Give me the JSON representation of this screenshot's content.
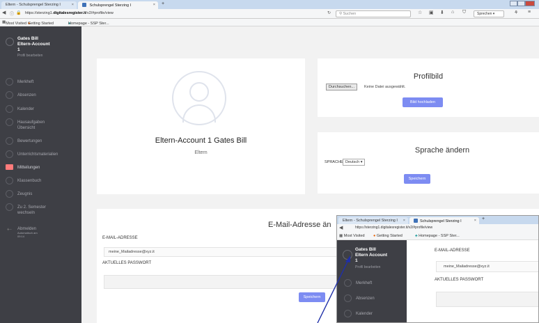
{
  "browser": {
    "tabs": [
      {
        "label": "Eltern - Schulsprengel Sterzing I"
      },
      {
        "label": "Schulsprengel Sterzing I"
      }
    ],
    "new_tab": "+",
    "url_prefix": "https://sterzing1.",
    "url_domain": "digitalesregister.it",
    "url_suffix": "/v2/#profile/view",
    "search_placeholder": "Suchen",
    "menu_label": "Sprechen",
    "bookmarks": [
      "Most Visited",
      "Getting Started",
      "Homepage - SSP Ster..."
    ]
  },
  "sidebar": {
    "user_name_line1": "Gates Bill",
    "user_name_line2": "Eltern-Account",
    "user_name_line3": "1",
    "edit_profile": "Profil bearbeiten",
    "items": [
      {
        "label": "Merkheft"
      },
      {
        "label": "Absenzen"
      },
      {
        "label": "Kalender"
      },
      {
        "label": "Hausaufgaben Übersicht"
      },
      {
        "label": "Bewertungen"
      },
      {
        "label": "Unterrichtsmaterialien"
      },
      {
        "label": "Mitteilungen"
      },
      {
        "label": "Klassenbuch"
      },
      {
        "label": "Zeugnis"
      },
      {
        "label": "Zu 2. Semester wechseln"
      }
    ],
    "logout": "Abmelden",
    "logout_sub_line1": "Automatisch am",
    "logout_sub_line2": "09:14"
  },
  "profile": {
    "name": "Eltern-Account 1 Gates Bill",
    "role": "Eltern"
  },
  "profilbild": {
    "title": "Profilbild",
    "browse_button": "Durchsuchen...",
    "no_file": "Keine Datei ausgewählt.",
    "upload_button": "Bild hochladen"
  },
  "language": {
    "title": "Sprache ändern",
    "label": "SPRACHE",
    "selected": "Deutsch",
    "save_button": "Speichern"
  },
  "email": {
    "title": "E-Mail-Adresse än",
    "email_label": "E-MAIL-ADRESSE",
    "email_value": "meine_Mailadresse@xyz.it",
    "password_label": "AKTUELLES PASSWORT",
    "password_value": "",
    "save_button": "Speichern"
  },
  "overlay": {
    "tabs": [
      {
        "label": "Eltern - Schulsprengel Sterzing I"
      },
      {
        "label": "Schulsprengel Sterzing I"
      }
    ],
    "new_tab": "+",
    "url": "https://sterzing1.digitalesregister.it/v2/#profile/view",
    "bookmarks": [
      "Most Visited",
      "Getting Started",
      "Homepage - SSP Ster..."
    ],
    "user_name_line1": "Gates Bill",
    "user_name_line2": "Eltern Account",
    "user_name_line3": "1",
    "edit_profile": "Profil bearbeiten",
    "items": [
      {
        "label": "Merkheft"
      },
      {
        "label": "Absenzen"
      },
      {
        "label": "Kalender"
      }
    ],
    "email_label": "E-MAIL-ADRESSE",
    "email_value": "meine_Mailadresse@xyz.it",
    "password_label": "AKTUELLES PASSWORT"
  },
  "colors": {
    "sidebar_bg": "#3e3f45",
    "accent": "#7d8cf2",
    "mail_icon": "#ff7b7b",
    "annotation_arrow": "#1f2fa8"
  }
}
